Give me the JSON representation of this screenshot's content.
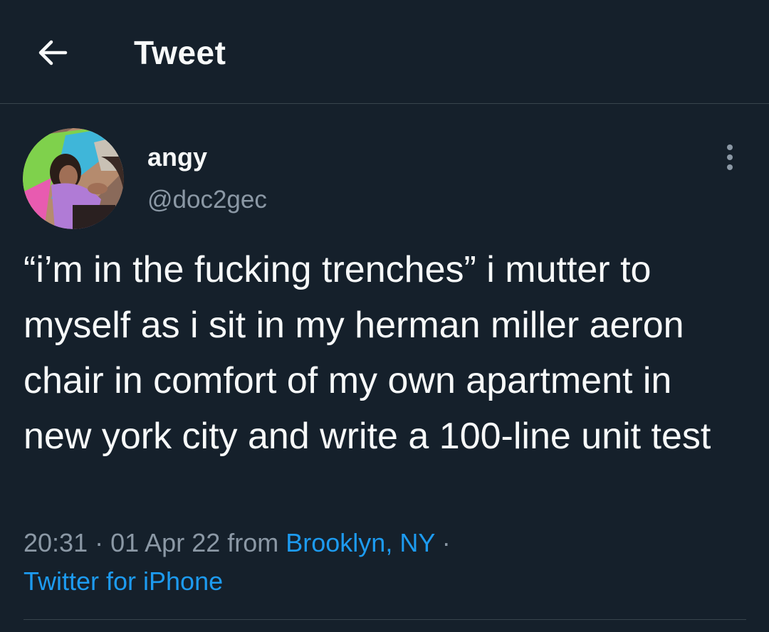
{
  "header": {
    "title": "Tweet",
    "back_icon": "arrow-left-icon"
  },
  "tweet": {
    "author": {
      "display_name": "angy",
      "handle": "@doc2gec",
      "avatar": "user-avatar-photo"
    },
    "more_icon": "more-vertical-icon",
    "text": "“i’m in the fucking trenches” i mutter to myself as i sit in my herman miller aeron chair in comfort of my own apartment in new york city and write a 100-line unit test",
    "time": "20:31",
    "date": "01 Apr 22",
    "from_label": "from",
    "location": "Brooklyn, NY",
    "source": "Twitter for iPhone"
  },
  "colors": {
    "background": "#15202b",
    "text": "#f7f9f9",
    "secondary_text": "#8b98a5",
    "link": "#1d9bf0",
    "divider": "#38444d"
  }
}
